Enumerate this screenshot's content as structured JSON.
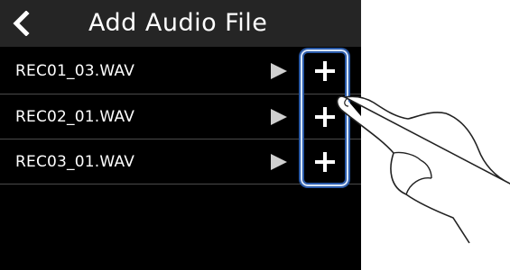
{
  "header": {
    "title": "Add Audio File",
    "back_icon": "chevron-left-icon"
  },
  "files": [
    {
      "name": "REC01_03.WAV"
    },
    {
      "name": "REC02_01.WAV"
    },
    {
      "name": "REC03_01.WAV"
    }
  ],
  "icons": {
    "play": "play-icon",
    "add": "plus-icon"
  },
  "colors": {
    "screen_bg": "#000000",
    "header_bg": "#252525",
    "text": "#ffffff",
    "play_icon": "#cfcfcf",
    "highlight_border": "#d8e6ff",
    "highlight_glow": "#2a5aa8"
  }
}
